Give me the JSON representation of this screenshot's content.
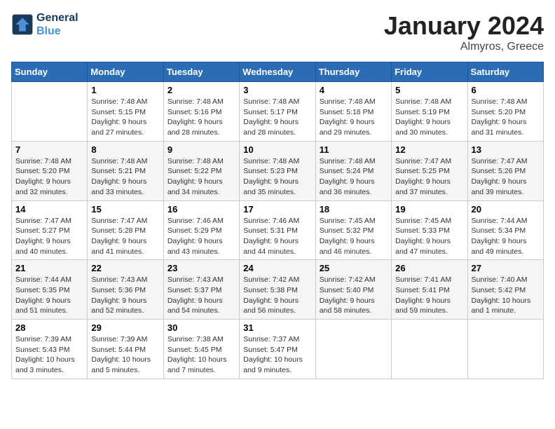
{
  "header": {
    "logo_line1": "General",
    "logo_line2": "Blue",
    "month": "January 2024",
    "location": "Almyros, Greece"
  },
  "weekdays": [
    "Sunday",
    "Monday",
    "Tuesday",
    "Wednesday",
    "Thursday",
    "Friday",
    "Saturday"
  ],
  "weeks": [
    [
      {
        "day": "",
        "info": ""
      },
      {
        "day": "1",
        "info": "Sunrise: 7:48 AM\nSunset: 5:15 PM\nDaylight: 9 hours\nand 27 minutes."
      },
      {
        "day": "2",
        "info": "Sunrise: 7:48 AM\nSunset: 5:16 PM\nDaylight: 9 hours\nand 28 minutes."
      },
      {
        "day": "3",
        "info": "Sunrise: 7:48 AM\nSunset: 5:17 PM\nDaylight: 9 hours\nand 28 minutes."
      },
      {
        "day": "4",
        "info": "Sunrise: 7:48 AM\nSunset: 5:18 PM\nDaylight: 9 hours\nand 29 minutes."
      },
      {
        "day": "5",
        "info": "Sunrise: 7:48 AM\nSunset: 5:19 PM\nDaylight: 9 hours\nand 30 minutes."
      },
      {
        "day": "6",
        "info": "Sunrise: 7:48 AM\nSunset: 5:20 PM\nDaylight: 9 hours\nand 31 minutes."
      }
    ],
    [
      {
        "day": "7",
        "info": "Sunrise: 7:48 AM\nSunset: 5:20 PM\nDaylight: 9 hours\nand 32 minutes."
      },
      {
        "day": "8",
        "info": "Sunrise: 7:48 AM\nSunset: 5:21 PM\nDaylight: 9 hours\nand 33 minutes."
      },
      {
        "day": "9",
        "info": "Sunrise: 7:48 AM\nSunset: 5:22 PM\nDaylight: 9 hours\nand 34 minutes."
      },
      {
        "day": "10",
        "info": "Sunrise: 7:48 AM\nSunset: 5:23 PM\nDaylight: 9 hours\nand 35 minutes."
      },
      {
        "day": "11",
        "info": "Sunrise: 7:48 AM\nSunset: 5:24 PM\nDaylight: 9 hours\nand 36 minutes."
      },
      {
        "day": "12",
        "info": "Sunrise: 7:47 AM\nSunset: 5:25 PM\nDaylight: 9 hours\nand 37 minutes."
      },
      {
        "day": "13",
        "info": "Sunrise: 7:47 AM\nSunset: 5:26 PM\nDaylight: 9 hours\nand 39 minutes."
      }
    ],
    [
      {
        "day": "14",
        "info": "Sunrise: 7:47 AM\nSunset: 5:27 PM\nDaylight: 9 hours\nand 40 minutes."
      },
      {
        "day": "15",
        "info": "Sunrise: 7:47 AM\nSunset: 5:28 PM\nDaylight: 9 hours\nand 41 minutes."
      },
      {
        "day": "16",
        "info": "Sunrise: 7:46 AM\nSunset: 5:29 PM\nDaylight: 9 hours\nand 43 minutes."
      },
      {
        "day": "17",
        "info": "Sunrise: 7:46 AM\nSunset: 5:31 PM\nDaylight: 9 hours\nand 44 minutes."
      },
      {
        "day": "18",
        "info": "Sunrise: 7:45 AM\nSunset: 5:32 PM\nDaylight: 9 hours\nand 46 minutes."
      },
      {
        "day": "19",
        "info": "Sunrise: 7:45 AM\nSunset: 5:33 PM\nDaylight: 9 hours\nand 47 minutes."
      },
      {
        "day": "20",
        "info": "Sunrise: 7:44 AM\nSunset: 5:34 PM\nDaylight: 9 hours\nand 49 minutes."
      }
    ],
    [
      {
        "day": "21",
        "info": "Sunrise: 7:44 AM\nSunset: 5:35 PM\nDaylight: 9 hours\nand 51 minutes."
      },
      {
        "day": "22",
        "info": "Sunrise: 7:43 AM\nSunset: 5:36 PM\nDaylight: 9 hours\nand 52 minutes."
      },
      {
        "day": "23",
        "info": "Sunrise: 7:43 AM\nSunset: 5:37 PM\nDaylight: 9 hours\nand 54 minutes."
      },
      {
        "day": "24",
        "info": "Sunrise: 7:42 AM\nSunset: 5:38 PM\nDaylight: 9 hours\nand 56 minutes."
      },
      {
        "day": "25",
        "info": "Sunrise: 7:42 AM\nSunset: 5:40 PM\nDaylight: 9 hours\nand 58 minutes."
      },
      {
        "day": "26",
        "info": "Sunrise: 7:41 AM\nSunset: 5:41 PM\nDaylight: 9 hours\nand 59 minutes."
      },
      {
        "day": "27",
        "info": "Sunrise: 7:40 AM\nSunset: 5:42 PM\nDaylight: 10 hours\nand 1 minute."
      }
    ],
    [
      {
        "day": "28",
        "info": "Sunrise: 7:39 AM\nSunset: 5:43 PM\nDaylight: 10 hours\nand 3 minutes."
      },
      {
        "day": "29",
        "info": "Sunrise: 7:39 AM\nSunset: 5:44 PM\nDaylight: 10 hours\nand 5 minutes."
      },
      {
        "day": "30",
        "info": "Sunrise: 7:38 AM\nSunset: 5:45 PM\nDaylight: 10 hours\nand 7 minutes."
      },
      {
        "day": "31",
        "info": "Sunrise: 7:37 AM\nSunset: 5:47 PM\nDaylight: 10 hours\nand 9 minutes."
      },
      {
        "day": "",
        "info": ""
      },
      {
        "day": "",
        "info": ""
      },
      {
        "day": "",
        "info": ""
      }
    ]
  ]
}
